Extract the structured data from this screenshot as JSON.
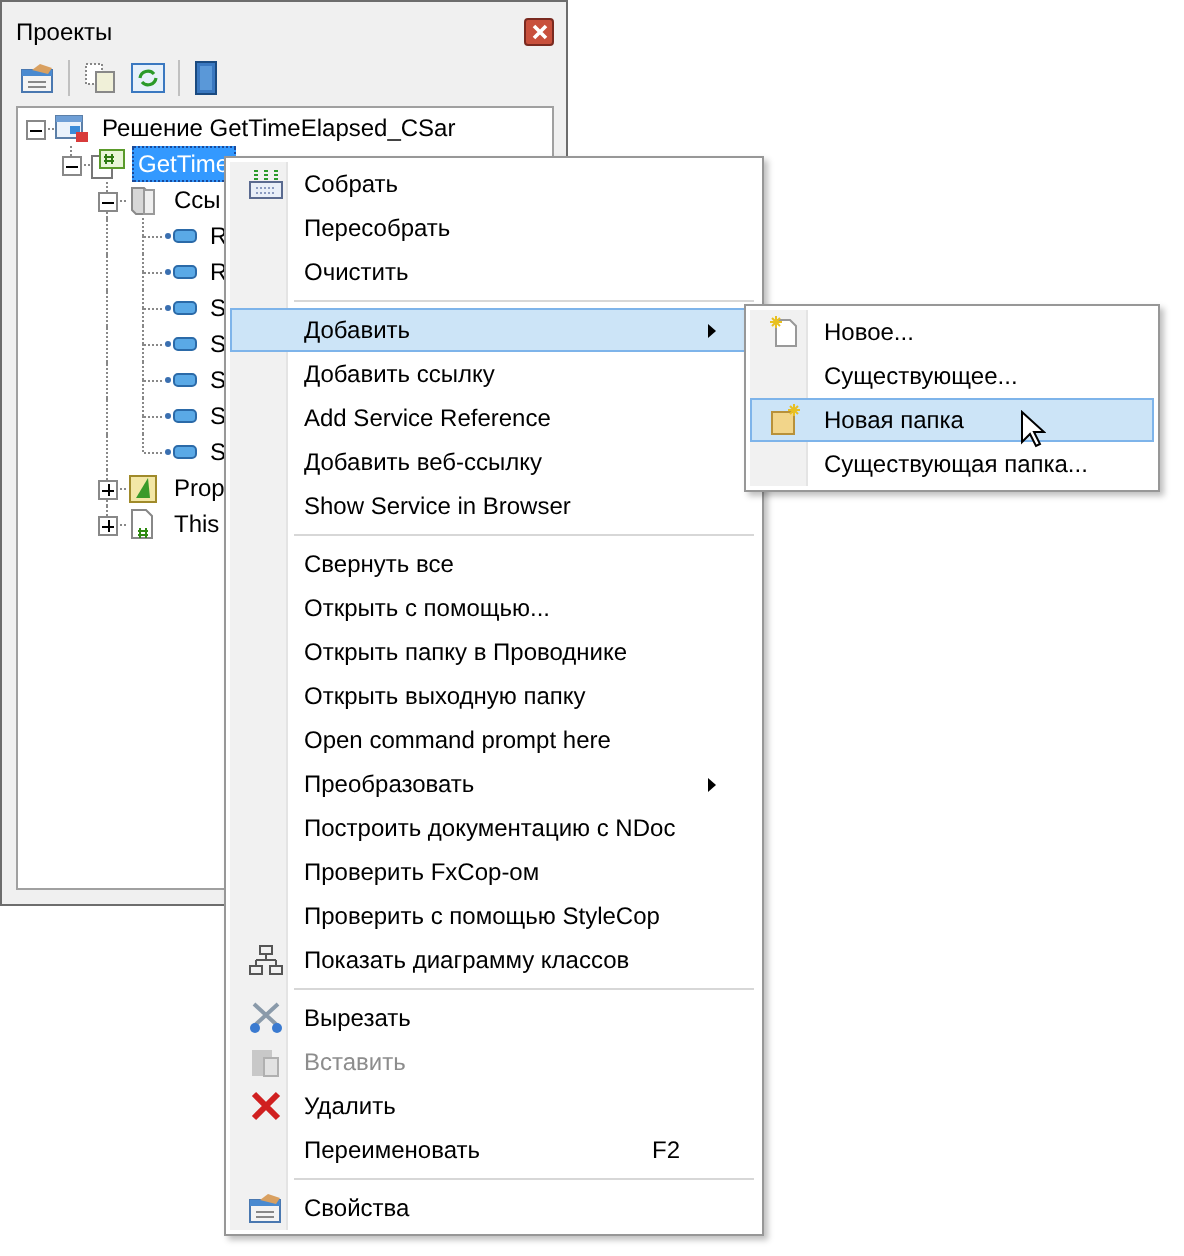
{
  "panel": {
    "title": "Проекты",
    "tree": [
      {
        "kind": "solution",
        "label": "Решение GetTimeElapsed_CSar",
        "expanded": true,
        "selected": false,
        "children": [
          {
            "kind": "project",
            "label": "GetTime",
            "expanded": true,
            "selected": true,
            "children": [
              {
                "kind": "references",
                "label": "Ссы",
                "expanded": true,
                "selected": false,
                "children": [
                  {
                    "kind": "reference",
                    "label": "R",
                    "selected": false
                  },
                  {
                    "kind": "reference",
                    "label": "R",
                    "selected": false
                  },
                  {
                    "kind": "reference",
                    "label": "S",
                    "selected": false
                  },
                  {
                    "kind": "reference",
                    "label": "S",
                    "selected": false
                  },
                  {
                    "kind": "reference",
                    "label": "S",
                    "selected": false
                  },
                  {
                    "kind": "reference",
                    "label": "S",
                    "selected": false
                  },
                  {
                    "kind": "reference",
                    "label": "S",
                    "selected": false
                  }
                ]
              },
              {
                "kind": "properties",
                "label": "Prop",
                "expanded": false,
                "selected": false
              },
              {
                "kind": "csfile",
                "label": "This",
                "expanded": false,
                "selected": false
              }
            ]
          }
        ]
      }
    ]
  },
  "context_menu": {
    "items": [
      {
        "kind": "item",
        "label": "Собрать",
        "selected": false,
        "disabled": false,
        "has_submenu": false
      },
      {
        "kind": "item",
        "label": "Пересобрать",
        "selected": false,
        "disabled": false,
        "has_submenu": false
      },
      {
        "kind": "item",
        "label": "Очистить",
        "selected": false,
        "disabled": false,
        "has_submenu": false
      },
      {
        "kind": "separator"
      },
      {
        "kind": "item",
        "label": "Добавить",
        "selected": true,
        "disabled": false,
        "has_submenu": true,
        "submenu_items": [
          {
            "label": "Новое...",
            "selected": false
          },
          {
            "label": "Существующее...",
            "selected": false
          },
          {
            "label": "Новая папка",
            "selected": true
          },
          {
            "label": "Существующая папка...",
            "selected": false
          }
        ]
      },
      {
        "kind": "item",
        "label": "Добавить ссылку",
        "selected": false,
        "disabled": false,
        "has_submenu": false
      },
      {
        "kind": "item",
        "label": "Add Service Reference",
        "selected": false,
        "disabled": false,
        "has_submenu": false
      },
      {
        "kind": "item",
        "label": "Добавить веб-ссылку",
        "selected": false,
        "disabled": false,
        "has_submenu": false
      },
      {
        "kind": "item",
        "label": "Show Service in Browser",
        "selected": false,
        "disabled": false,
        "has_submenu": false
      },
      {
        "kind": "separator"
      },
      {
        "kind": "item",
        "label": "Свернуть все",
        "selected": false,
        "disabled": false,
        "has_submenu": false
      },
      {
        "kind": "item",
        "label": "Открыть с помощью...",
        "selected": false,
        "disabled": false,
        "has_submenu": false
      },
      {
        "kind": "item",
        "label": "Открыть папку в Проводнике",
        "selected": false,
        "disabled": false,
        "has_submenu": false
      },
      {
        "kind": "item",
        "label": "Открыть выходную папку",
        "selected": false,
        "disabled": false,
        "has_submenu": false
      },
      {
        "kind": "item",
        "label": "Open command prompt here",
        "selected": false,
        "disabled": false,
        "has_submenu": false
      },
      {
        "kind": "item",
        "label": "Преобразовать",
        "selected": false,
        "disabled": false,
        "has_submenu": true
      },
      {
        "kind": "item",
        "label": "Построить документацию с NDoc",
        "selected": false,
        "disabled": false,
        "has_submenu": false
      },
      {
        "kind": "item",
        "label": "Проверить FxCop-ом",
        "selected": false,
        "disabled": false,
        "has_submenu": false
      },
      {
        "kind": "item",
        "label": "Проверить с помощью StyleCop",
        "selected": false,
        "disabled": false,
        "has_submenu": false
      },
      {
        "kind": "item",
        "label": "Показать диаграмму классов",
        "selected": false,
        "disabled": false,
        "has_submenu": false
      },
      {
        "kind": "separator"
      },
      {
        "kind": "item",
        "label": "Вырезать",
        "selected": false,
        "disabled": false,
        "has_submenu": false
      },
      {
        "kind": "item",
        "label": "Вставить",
        "selected": false,
        "disabled": true,
        "has_submenu": false
      },
      {
        "kind": "item",
        "label": "Удалить",
        "selected": false,
        "disabled": false,
        "has_submenu": false
      },
      {
        "kind": "item",
        "label": "Переименовать",
        "shortcut": "F2",
        "selected": false,
        "disabled": false,
        "has_submenu": false
      },
      {
        "kind": "separator"
      },
      {
        "kind": "item",
        "label": "Свойства",
        "selected": false,
        "disabled": false,
        "has_submenu": false
      }
    ]
  }
}
